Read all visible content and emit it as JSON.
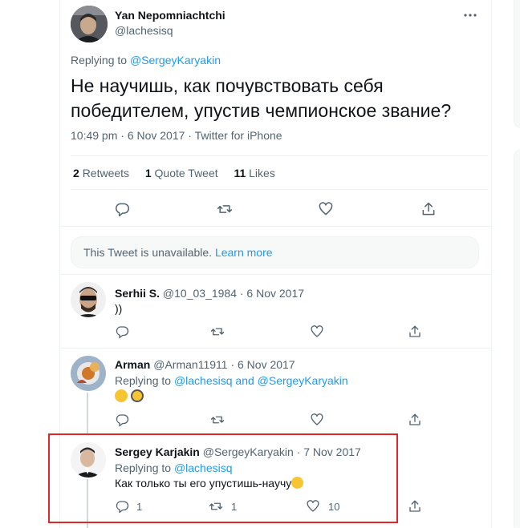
{
  "main_tweet": {
    "author_name": "Yan Nepomniachtchi",
    "author_handle": "@lachesisq",
    "replying_prefix": "Replying to ",
    "replying_to": "@SergeyKaryakin",
    "text": "Не научишь, как почувствовать себя победителем, упустив чемпионское звание?",
    "meta": "10:49 pm · 6 Nov 2017 · Twitter for iPhone",
    "stats": {
      "retweets_count": "2",
      "retweets_label": "Retweets",
      "quotes_count": "1",
      "quotes_label": "Quote Tweet",
      "likes_count": "11",
      "likes_label": "Likes"
    }
  },
  "unavailable": {
    "text": "This Tweet is unavailable.",
    "link": "Learn more"
  },
  "replies": [
    {
      "name": "Serhii S.",
      "handle_date": "@10_03_1984 · 6 Nov 2017",
      "text": "))"
    },
    {
      "name": "Arman",
      "handle_date": "@Arman11911 · 6 Nov 2017",
      "replying_prefix": "Replying to ",
      "replying_to": "@lachesisq and @SergeyKaryakin",
      "emoji": [
        "thinking-face",
        "face-with-monocle"
      ]
    },
    {
      "name": "Sergey Karjakin",
      "handle_date": "@SergeyKaryakin · 7 Nov 2017",
      "replying_prefix": "Replying to ",
      "replying_to": "@lachesisq",
      "text": "Как только ты его упустишь-научу",
      "emoji": [
        "disappointed-face"
      ],
      "reply_count": "1",
      "retweet_count": "1",
      "like_count": "10"
    }
  ],
  "colors": {
    "accent": "#1d9bf0",
    "secondary_text": "#536471",
    "highlight_border": "#e0262b"
  }
}
